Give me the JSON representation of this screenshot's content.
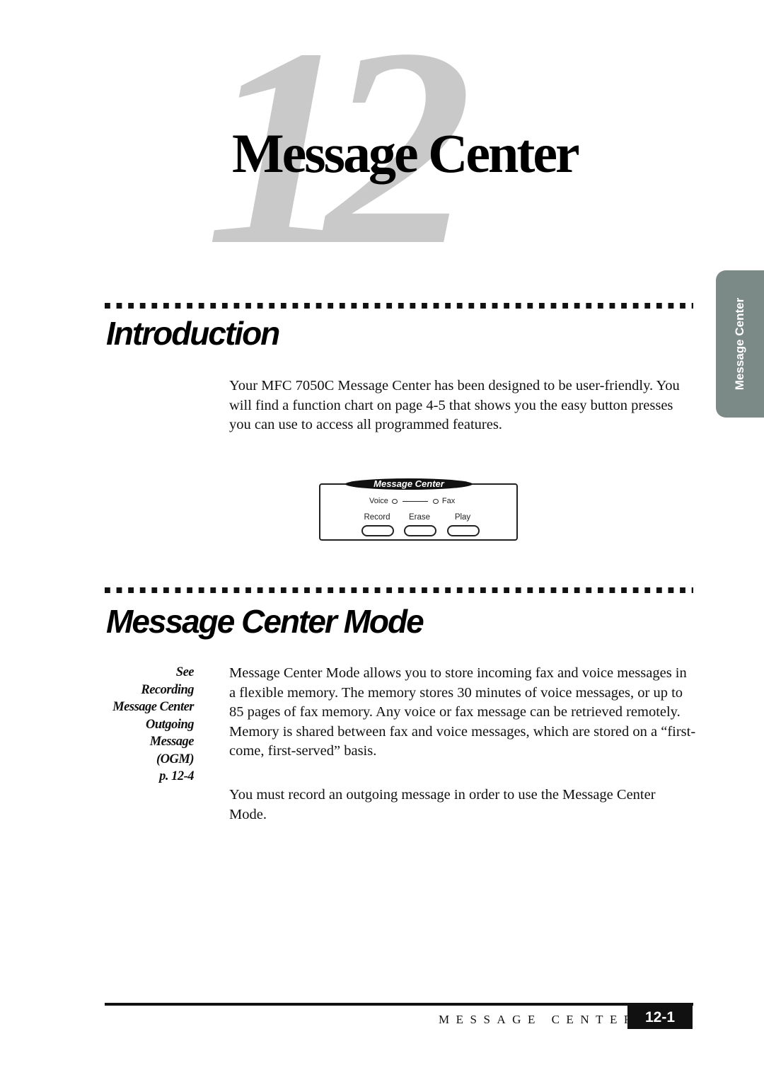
{
  "chapter": {
    "number": "12",
    "title": "Message Center"
  },
  "side_tab": {
    "label": "Message Center",
    "color": "#7c8a87"
  },
  "sections": [
    {
      "heading": "Introduction",
      "paragraphs": [
        "Your MFC 7050C Message Center has been designed to be user-friendly. You will find a function chart on page 4-5 that shows you the easy button presses you can use to access all programmed features."
      ]
    },
    {
      "heading": "Message Center Mode",
      "paragraphs": [
        "Message Center Mode allows you to store incoming fax and voice messages in a flexible memory. The memory stores 30 minutes of voice messages, or up to 85 pages of fax memory. Any voice or fax message can be retrieved remotely. Memory is shared between fax and voice messages, which are stored on a “first-come, first-served” basis.",
        "You must record an outgoing message in order to use the Message Center Mode."
      ],
      "margin_note": [
        "See",
        "Recording",
        "Message Center",
        "Outgoing",
        "Message",
        "(OGM)",
        "p. 12-4"
      ]
    }
  ],
  "panel": {
    "label": "Message Center",
    "led_left": "Voice",
    "led_right": "Fax",
    "buttons": [
      "Record",
      "Erase",
      "Play"
    ]
  },
  "footer": {
    "title": "MESSAGE CENTER",
    "page": "12-1"
  }
}
